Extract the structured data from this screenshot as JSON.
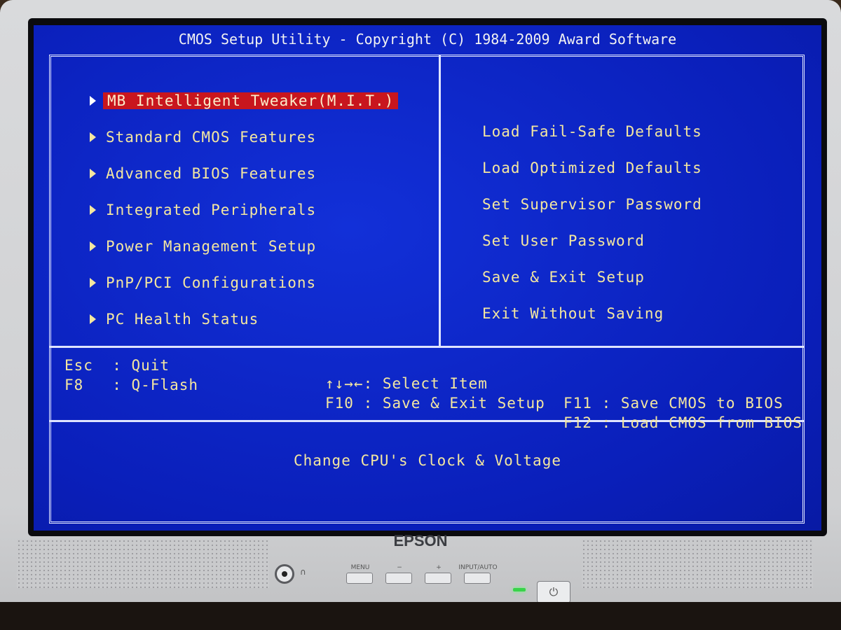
{
  "monitor": {
    "brand": "EPSON",
    "buttons": [
      "MENU",
      "−",
      "+",
      "INPUT/AUTO"
    ],
    "power_icon": "⏻"
  },
  "bios": {
    "title": "CMOS Setup Utility - Copyright (C) 1984-2009 Award Software",
    "left_menu": [
      {
        "label": "MB Intelligent Tweaker(M.I.T.)",
        "selected": true
      },
      {
        "label": "Standard CMOS Features",
        "selected": false
      },
      {
        "label": "Advanced BIOS Features",
        "selected": false
      },
      {
        "label": "Integrated Peripherals",
        "selected": false
      },
      {
        "label": "Power Management Setup",
        "selected": false
      },
      {
        "label": "PnP/PCI Configurations",
        "selected": false
      },
      {
        "label": "PC Health Status",
        "selected": false
      }
    ],
    "right_menu": [
      {
        "label": "Load Fail-Safe Defaults"
      },
      {
        "label": "Load Optimized Defaults"
      },
      {
        "label": "Set Supervisor Password"
      },
      {
        "label": "Set User Password"
      },
      {
        "label": "Save & Exit Setup"
      },
      {
        "label": "Exit Without Saving"
      }
    ],
    "keys": {
      "col1": [
        "Esc  : Quit",
        "F8   : Q-Flash"
      ],
      "col2": [
        "↑↓→←: Select Item",
        "F10 : Save & Exit Setup"
      ],
      "col3": [
        "F11 : Save CMOS to BIOS",
        "F12 : Load CMOS from BIOS"
      ]
    },
    "help_text": "Change CPU's Clock & Voltage",
    "colors": {
      "background": "#0c22c8",
      "text": "#f4e7a0",
      "highlight": "#c8161e",
      "border": "#dfe4ff"
    }
  }
}
